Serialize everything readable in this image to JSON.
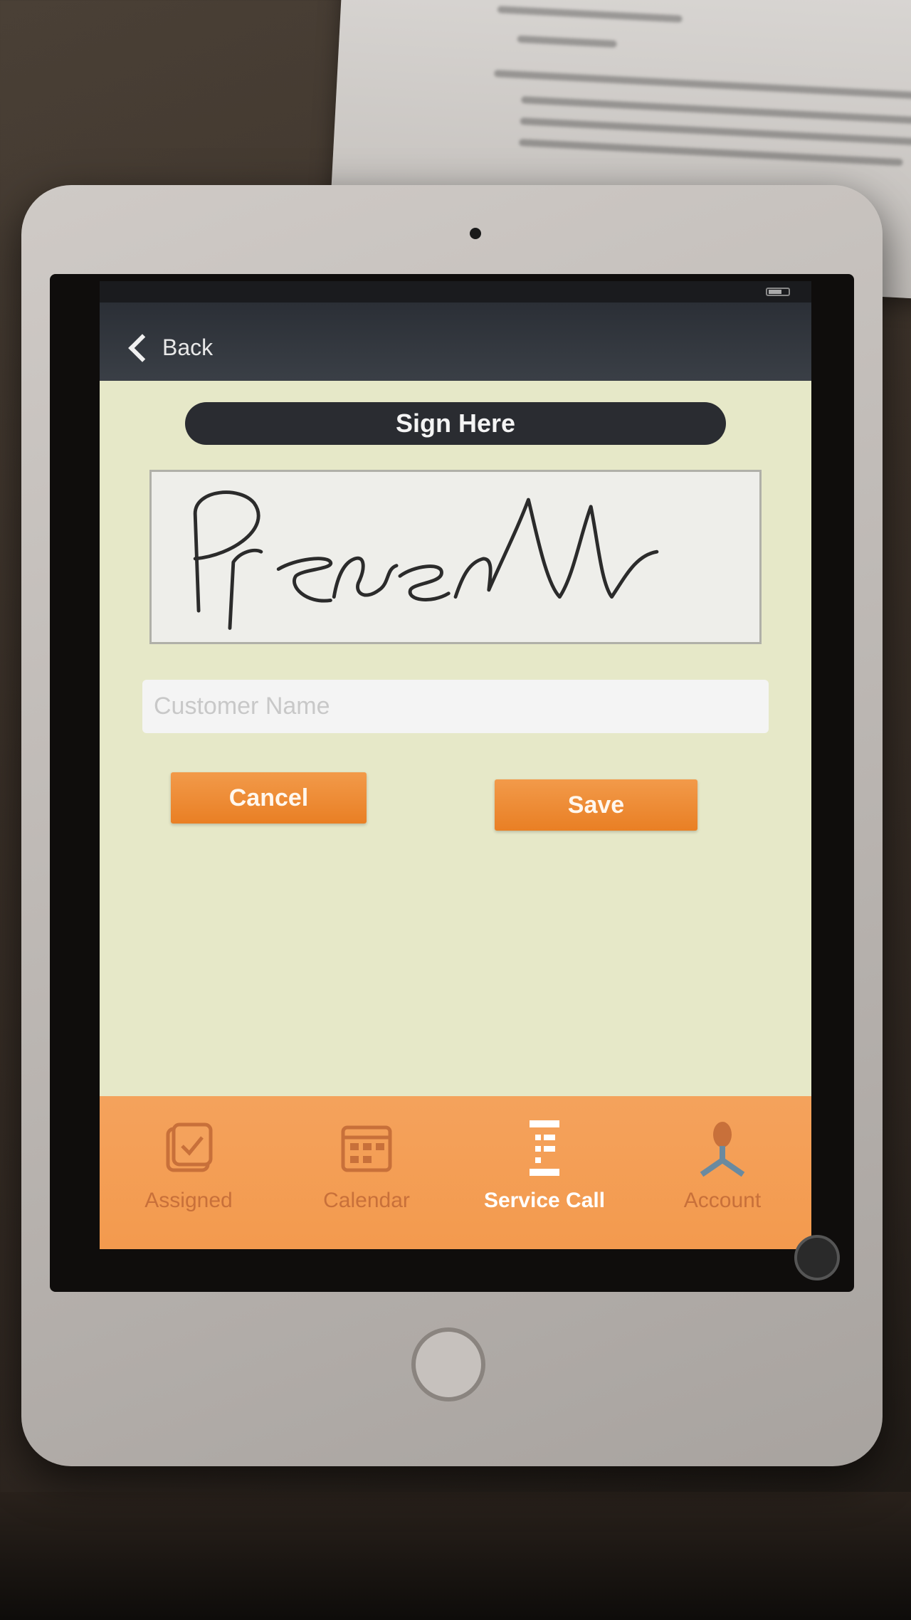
{
  "nav": {
    "back_label": "Back"
  },
  "signature": {
    "header": "Sign Here",
    "signed_text": "PrcreN"
  },
  "form": {
    "customer_name_placeholder": "Customer Name",
    "customer_name_value": ""
  },
  "actions": {
    "cancel_label": "Cancel",
    "save_label": "Save"
  },
  "tab_bar": {
    "active_tab": "Service Call",
    "tabs": [
      {
        "label": "Assigned",
        "icon": "assigned-icon"
      },
      {
        "label": "Calendar",
        "icon": "calendar-icon"
      },
      {
        "label": "Service Call",
        "icon": "service-call-icon"
      },
      {
        "label": "Account",
        "icon": "account-icon"
      }
    ]
  },
  "colors": {
    "screen_bg": "#e6e8c8",
    "nav_bg": "#2b2f36",
    "accent_orange": "#e97f24",
    "tab_bar_bg": "#f4a25c",
    "tab_inactive_text": "#c8703a"
  }
}
